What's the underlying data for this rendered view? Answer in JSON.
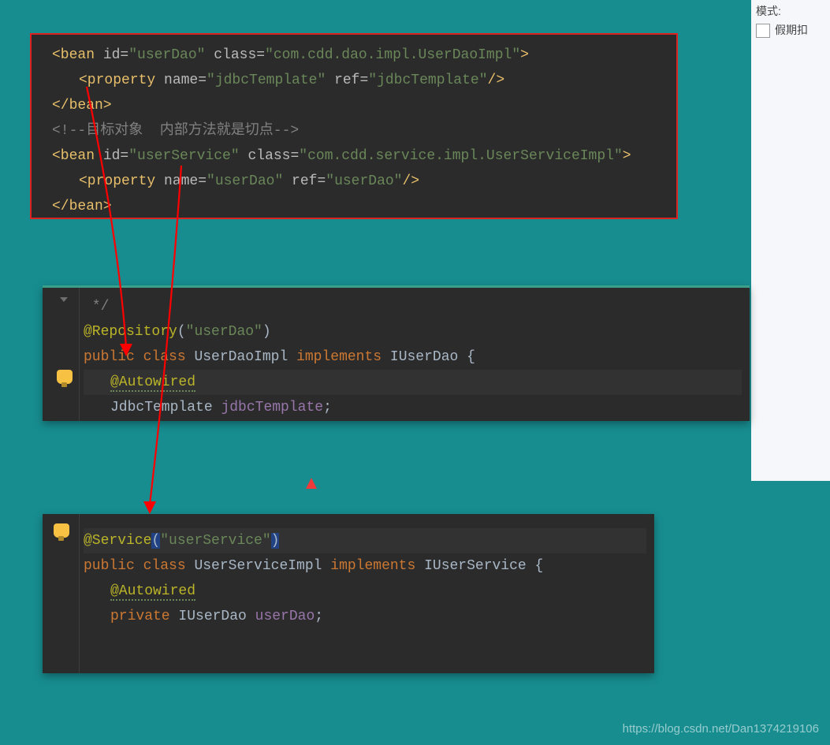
{
  "sidebar": {
    "title": "模式:",
    "checkbox_label": "假期扣"
  },
  "xml": {
    "l1_open": "<bean",
    "l1_id_attr": " id=",
    "l1_id_val": "\"userDao\"",
    "l1_class_attr": " class=",
    "l1_class_val": "\"com.cdd.dao.impl.UserDaoImpl\"",
    "l1_close": ">",
    "l2_open": "<property",
    "l2_name_attr": " name=",
    "l2_name_val": "\"jdbcTemplate\"",
    "l2_ref_attr": " ref=",
    "l2_ref_val": "\"jdbcTemplate\"",
    "l2_close": "/>",
    "l3": "</bean>",
    "l4": "<!--目标对象  内部方法就是切点-->",
    "l5_open": "<bean",
    "l5_id_attr": " id=",
    "l5_id_val": "\"userService\"",
    "l5_class_attr": " class=",
    "l5_class_val": "\"com.cdd.service.impl.UserServiceImpl\"",
    "l5_close": ">",
    "l6_open": "<property",
    "l6_name_attr": " name=",
    "l6_name_val": "\"userDao\"",
    "l6_ref_attr": " ref=",
    "l6_ref_val": "\"userDao\"",
    "l6_close": "/>",
    "l7": "</bean>"
  },
  "dao": {
    "l1": " */",
    "l2_ann": "@Repository",
    "l2_p": "(",
    "l2_val": "\"userDao\"",
    "l2_pc": ")",
    "l3_pub": "public ",
    "l3_cls": "class ",
    "l3_name": "UserDaoImpl ",
    "l3_impl": "implements ",
    "l3_iface": "IUserDao {",
    "l4": "@Autowired",
    "l5_type": "JdbcTemplate ",
    "l5_name": "jdbcTemplate",
    "l5_sc": ";"
  },
  "svc": {
    "l1_ann": "@Service",
    "l1_p": "(",
    "l1_val": "\"userService\"",
    "l1_pc": ")",
    "l2_pub": "public ",
    "l2_cls": "class ",
    "l2_name": "UserServiceImpl ",
    "l2_impl": "implements ",
    "l2_iface": "IUserService {",
    "l3": "@Autowired",
    "l4_priv": "private ",
    "l4_type": "IUserDao ",
    "l4_name": "userDao",
    "l4_sc": ";"
  },
  "watermark": "https://blog.csdn.net/Dan1374219106"
}
